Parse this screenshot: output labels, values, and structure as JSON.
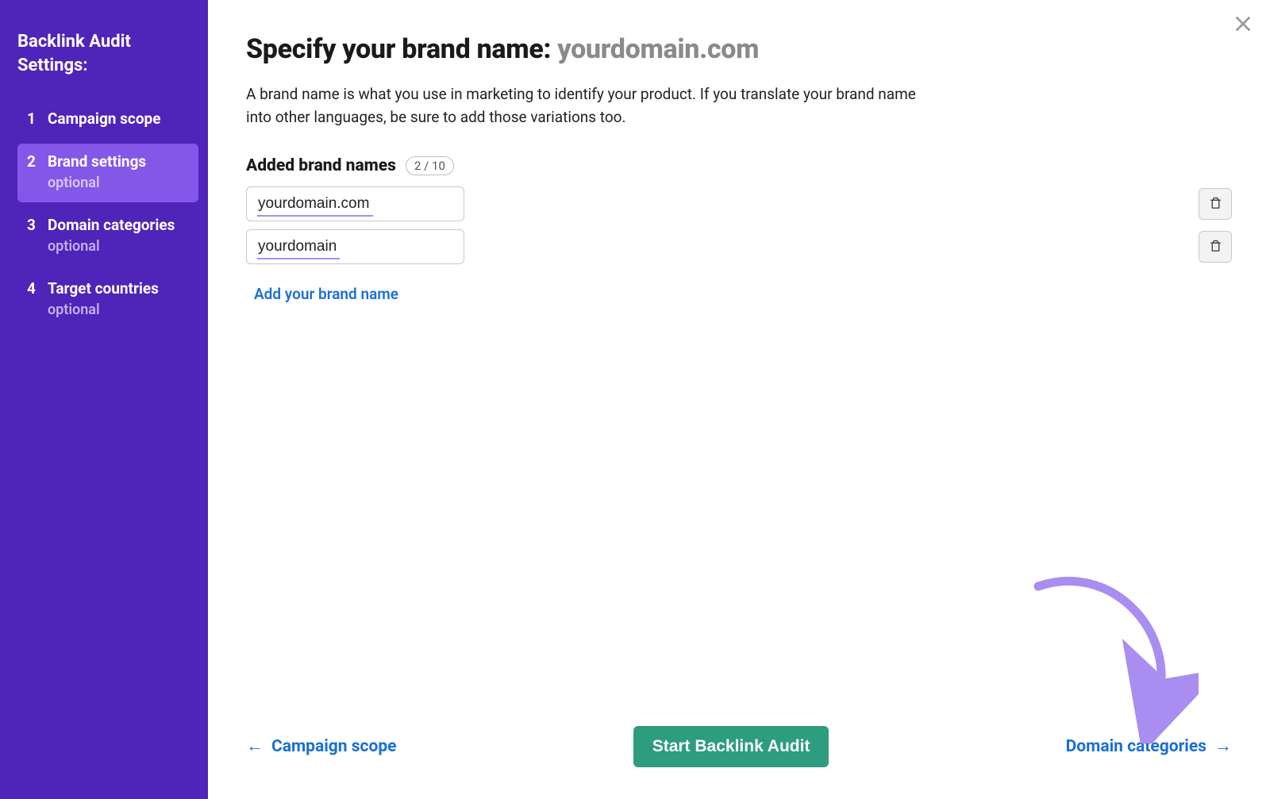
{
  "sidebar": {
    "title": "Backlink Audit Settings:",
    "steps": [
      {
        "num": "1",
        "label": "Campaign scope",
        "sublabel": null,
        "active": false
      },
      {
        "num": "2",
        "label": "Brand settings",
        "sublabel": "optional",
        "active": true
      },
      {
        "num": "3",
        "label": "Domain categories",
        "sublabel": "optional",
        "active": false
      },
      {
        "num": "4",
        "label": "Target countries",
        "sublabel": "optional",
        "active": false
      }
    ]
  },
  "header": {
    "title_prefix": "Specify your brand name: ",
    "title_domain": "yourdomain.com",
    "description": "A brand name is what you use in marketing to identify your product. If you translate your brand name into other languages, be sure to add those variations too."
  },
  "brand": {
    "section_label": "Added brand names",
    "count_text": "2 / 10",
    "items": [
      {
        "value": "yourdomain.com"
      },
      {
        "value": "yourdomain"
      }
    ],
    "add_link_label": "Add your brand name"
  },
  "footer": {
    "back_label": "Campaign scope",
    "primary_label": "Start Backlink Audit",
    "next_label": "Domain categories"
  }
}
